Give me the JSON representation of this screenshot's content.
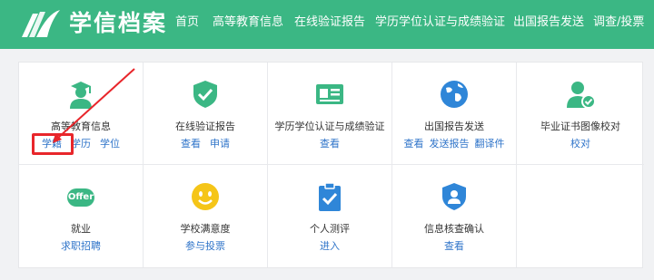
{
  "header": {
    "brand": "学信档案",
    "nav": [
      "首页",
      "高等教育信息",
      "在线验证报告",
      "学历学位认证与成绩验证",
      "出国报告发送",
      "调查/投票"
    ]
  },
  "grid": {
    "row1": [
      {
        "title": "高等教育信息",
        "links": [
          "学籍",
          "学历",
          "学位"
        ],
        "icon": "graduate-icon"
      },
      {
        "title": "在线验证报告",
        "links": [
          "查看",
          "申请"
        ],
        "icon": "shield-check-icon"
      },
      {
        "title": "学历学位认证与成绩验证",
        "links": [
          "查看"
        ],
        "icon": "id-card-icon"
      },
      {
        "title": "出国报告发送",
        "links": [
          "查看",
          "发送报告",
          "翻译件"
        ],
        "icon": "globe-icon"
      },
      {
        "title": "毕业证书图像校对",
        "links": [
          "校对"
        ],
        "icon": "user-check-icon"
      }
    ],
    "row2": [
      {
        "title": "就业",
        "links": [
          "求职招聘"
        ],
        "icon": "offer-badge-icon",
        "badge": "Offer"
      },
      {
        "title": "学校满意度",
        "links": [
          "参与投票"
        ],
        "icon": "smiley-icon"
      },
      {
        "title": "个人测评",
        "links": [
          "进入"
        ],
        "icon": "clipboard-check-icon"
      },
      {
        "title": "信息核查确认",
        "links": [
          "查看"
        ],
        "icon": "user-shield-icon"
      }
    ]
  },
  "colors": {
    "header": "#3bb784",
    "link": "#2f74c9",
    "icon_green": "#3bb784",
    "icon_blue": "#2f86d8",
    "icon_yellow": "#f5c518",
    "highlight": "#e8262b"
  }
}
